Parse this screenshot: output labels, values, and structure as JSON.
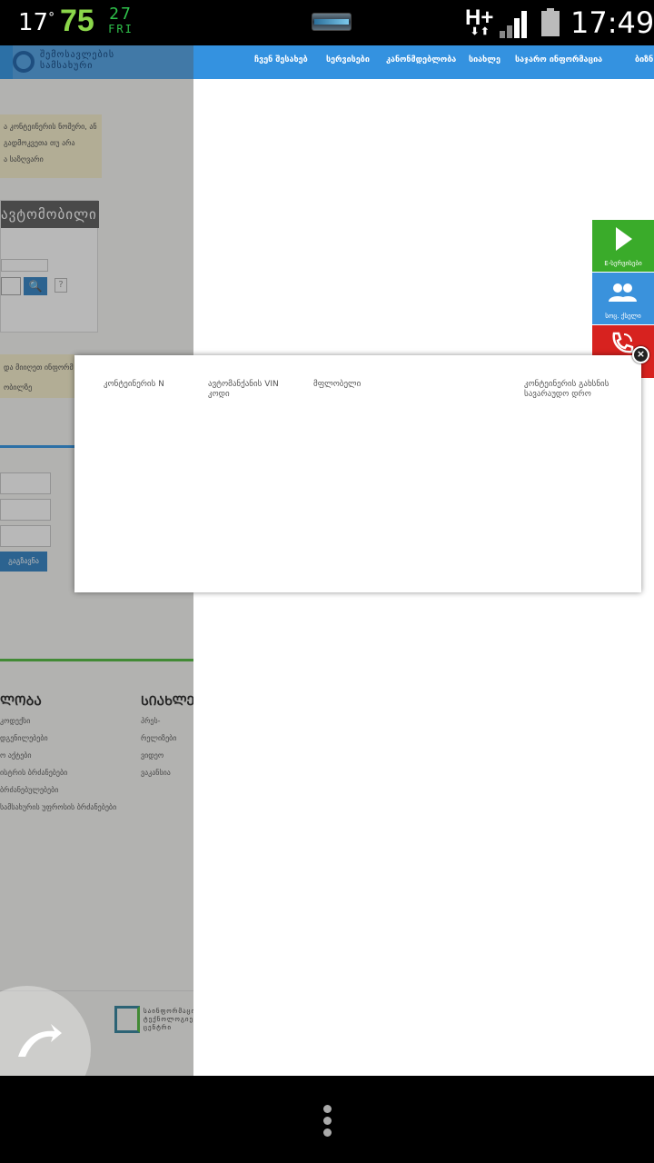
{
  "status_bar": {
    "temperature": "17",
    "degree_symbol": "°",
    "battery_percent": "75",
    "day_of_month": "27",
    "weekday": "FRI",
    "network_type": "H+",
    "network_arrows": "⬇⬆",
    "time": "17:49"
  },
  "left_page": {
    "logo_line1": "შემოსავლების",
    "logo_line2": "სამსახური",
    "notice_lines": [
      "ა კონტეინერის ნომერი, ან",
      "გადმოკვეთა თუ არა",
      "ა საზღვარი"
    ],
    "card_title": "ავტომობილი",
    "search_glyph": "🔍",
    "help_glyph": "?",
    "notice2_lines": [
      "და მიიღეთ ინფორმ",
      "ობილზე"
    ],
    "submit_label": "გაგზავნა",
    "footer_heading_left": "ᲚᲝᲑᲐ",
    "footer_heading_right": "ᲡᲘᲐᲮᲚᲔ",
    "footer_list_left": [
      "კოდექსი",
      "დგენილებები",
      "ო აქტები",
      "ისტრის ბრძანებები",
      "ბრძანებულებები",
      "სამსახურის უფროსის ბრძანებები"
    ],
    "footer_list_right": [
      "პრეს-რელიზები",
      "ვიდეო",
      "ვაკანსია"
    ],
    "ic_logo_lines": [
      "საინფორმაციო",
      "ტექნოლოგიების",
      "ცენტრი"
    ]
  },
  "top_nav": {
    "items": [
      "ჩვენ შესახებ",
      "სერვისები",
      "კანონმდებლობა",
      "სიახლე",
      "საჯარო ინფორმაცია",
      "ბიზნ"
    ]
  },
  "side_buttons": {
    "services_label": "E-სერვისები",
    "social_label": "სოც. ქსელი"
  },
  "modal": {
    "columns": [
      "კონტეინერის N",
      "ავტომანქანის VIN კოდი",
      "მფლობელი",
      "კონტეინერის გახსნის სავარაუდო დრო"
    ],
    "close_glyph": "×"
  }
}
